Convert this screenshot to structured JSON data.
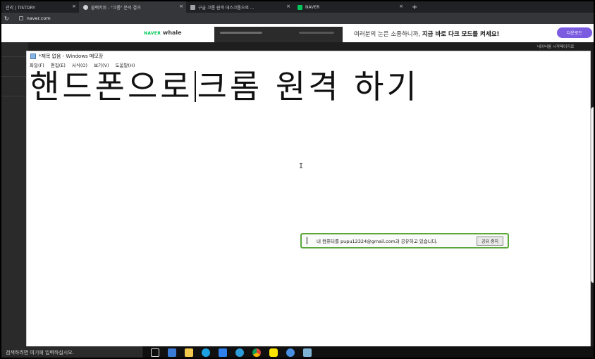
{
  "browser": {
    "tabs": [
      {
        "label": "관리 | TISTORY",
        "close": "×"
      },
      {
        "label": "블랙키위 - \"크롬\" 분석 결과",
        "close": "×"
      },
      {
        "label": "구글 크롬 원격 데스크톱으로 ...",
        "close": "×"
      },
      {
        "label": "NAVER",
        "close": "×"
      }
    ],
    "new_tab": "+",
    "url": "naver.com"
  },
  "banner": {
    "logo_brand": "NAVER",
    "logo_product": "whale",
    "message_prefix": "여러분의 눈은 소중하니까,",
    "message_bold": "지금 바로 다크 모드를 켜세요!",
    "button": "다운로드",
    "set_homepage": "네이버를 시작페이지로"
  },
  "notepad": {
    "title": "*제목 없음 - Windows 메모장",
    "menu": [
      "파일(F)",
      "편집(E)",
      "서식(O)",
      "보기(V)",
      "도움말(H)"
    ],
    "text_before_caret": "핸드폰으로",
    "text_after_caret": "크롬 원격 하기"
  },
  "share_notice": {
    "message": "내 컴퓨터를 pupu12324@gmail.com과 공유하고 있습니다.",
    "stop_button": "공유 중지"
  },
  "taskbar": {
    "search_placeholder": "검색하려면 여기에 입력하십시오."
  }
}
